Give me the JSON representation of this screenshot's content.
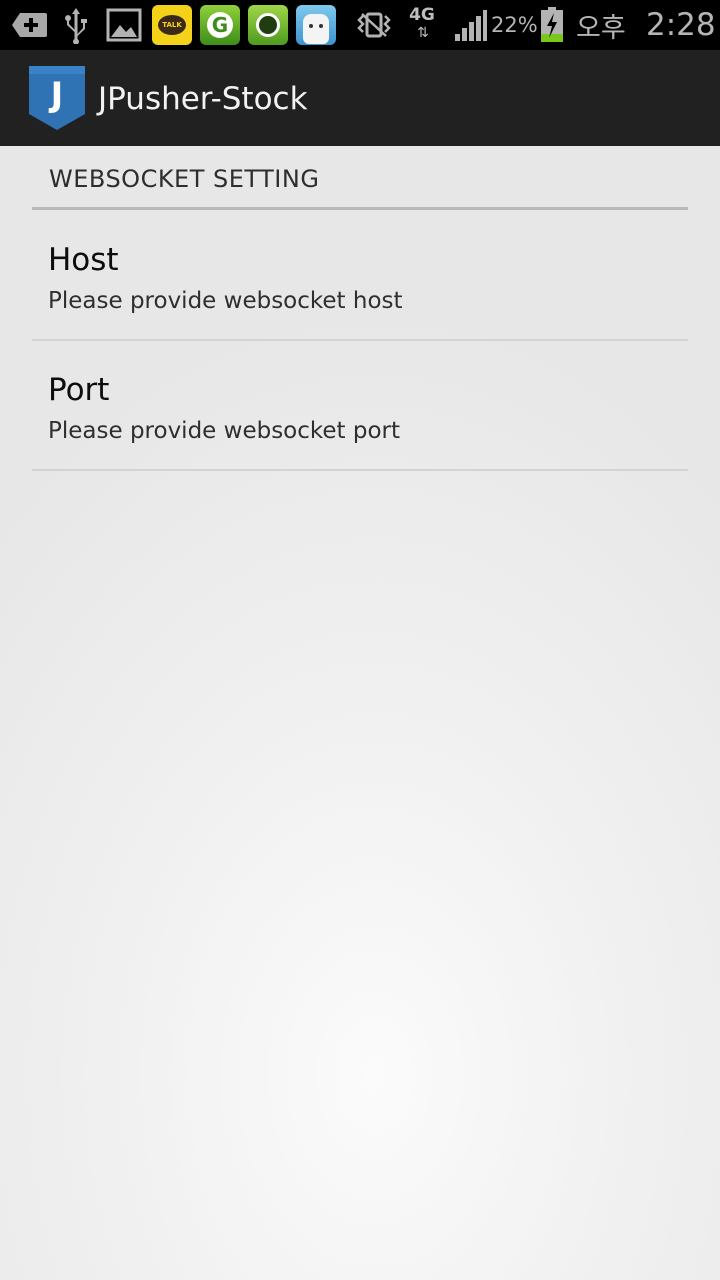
{
  "status_bar": {
    "icons": [
      "add-notification-icon",
      "usb-icon",
      "gallery-icon",
      "kakaotalk-app-icon",
      "grep-app-icon",
      "q-app-icon",
      "face-app-icon",
      "vibrate-icon",
      "signal-icon",
      "battery-charging-icon"
    ],
    "talk_label": "TALK",
    "network_type": "4G",
    "network_arrows": "⇅",
    "battery_percent": "22%",
    "ampm": "오후",
    "time": "2:28",
    "colors": {
      "background": "#000000",
      "icon": "#b7b7b7",
      "battery_charge": "#7cc81a"
    }
  },
  "action_bar": {
    "logo_letter": "J",
    "title": "JPusher-Stock",
    "colors": {
      "background": "#212121",
      "logo": "#2f73b5"
    }
  },
  "preferences": {
    "category_title": "WEBSOCKET SETTING",
    "items": [
      {
        "title": "Host",
        "summary": "Please provide websocket host"
      },
      {
        "title": "Port",
        "summary": "Please provide websocket port"
      }
    ]
  }
}
